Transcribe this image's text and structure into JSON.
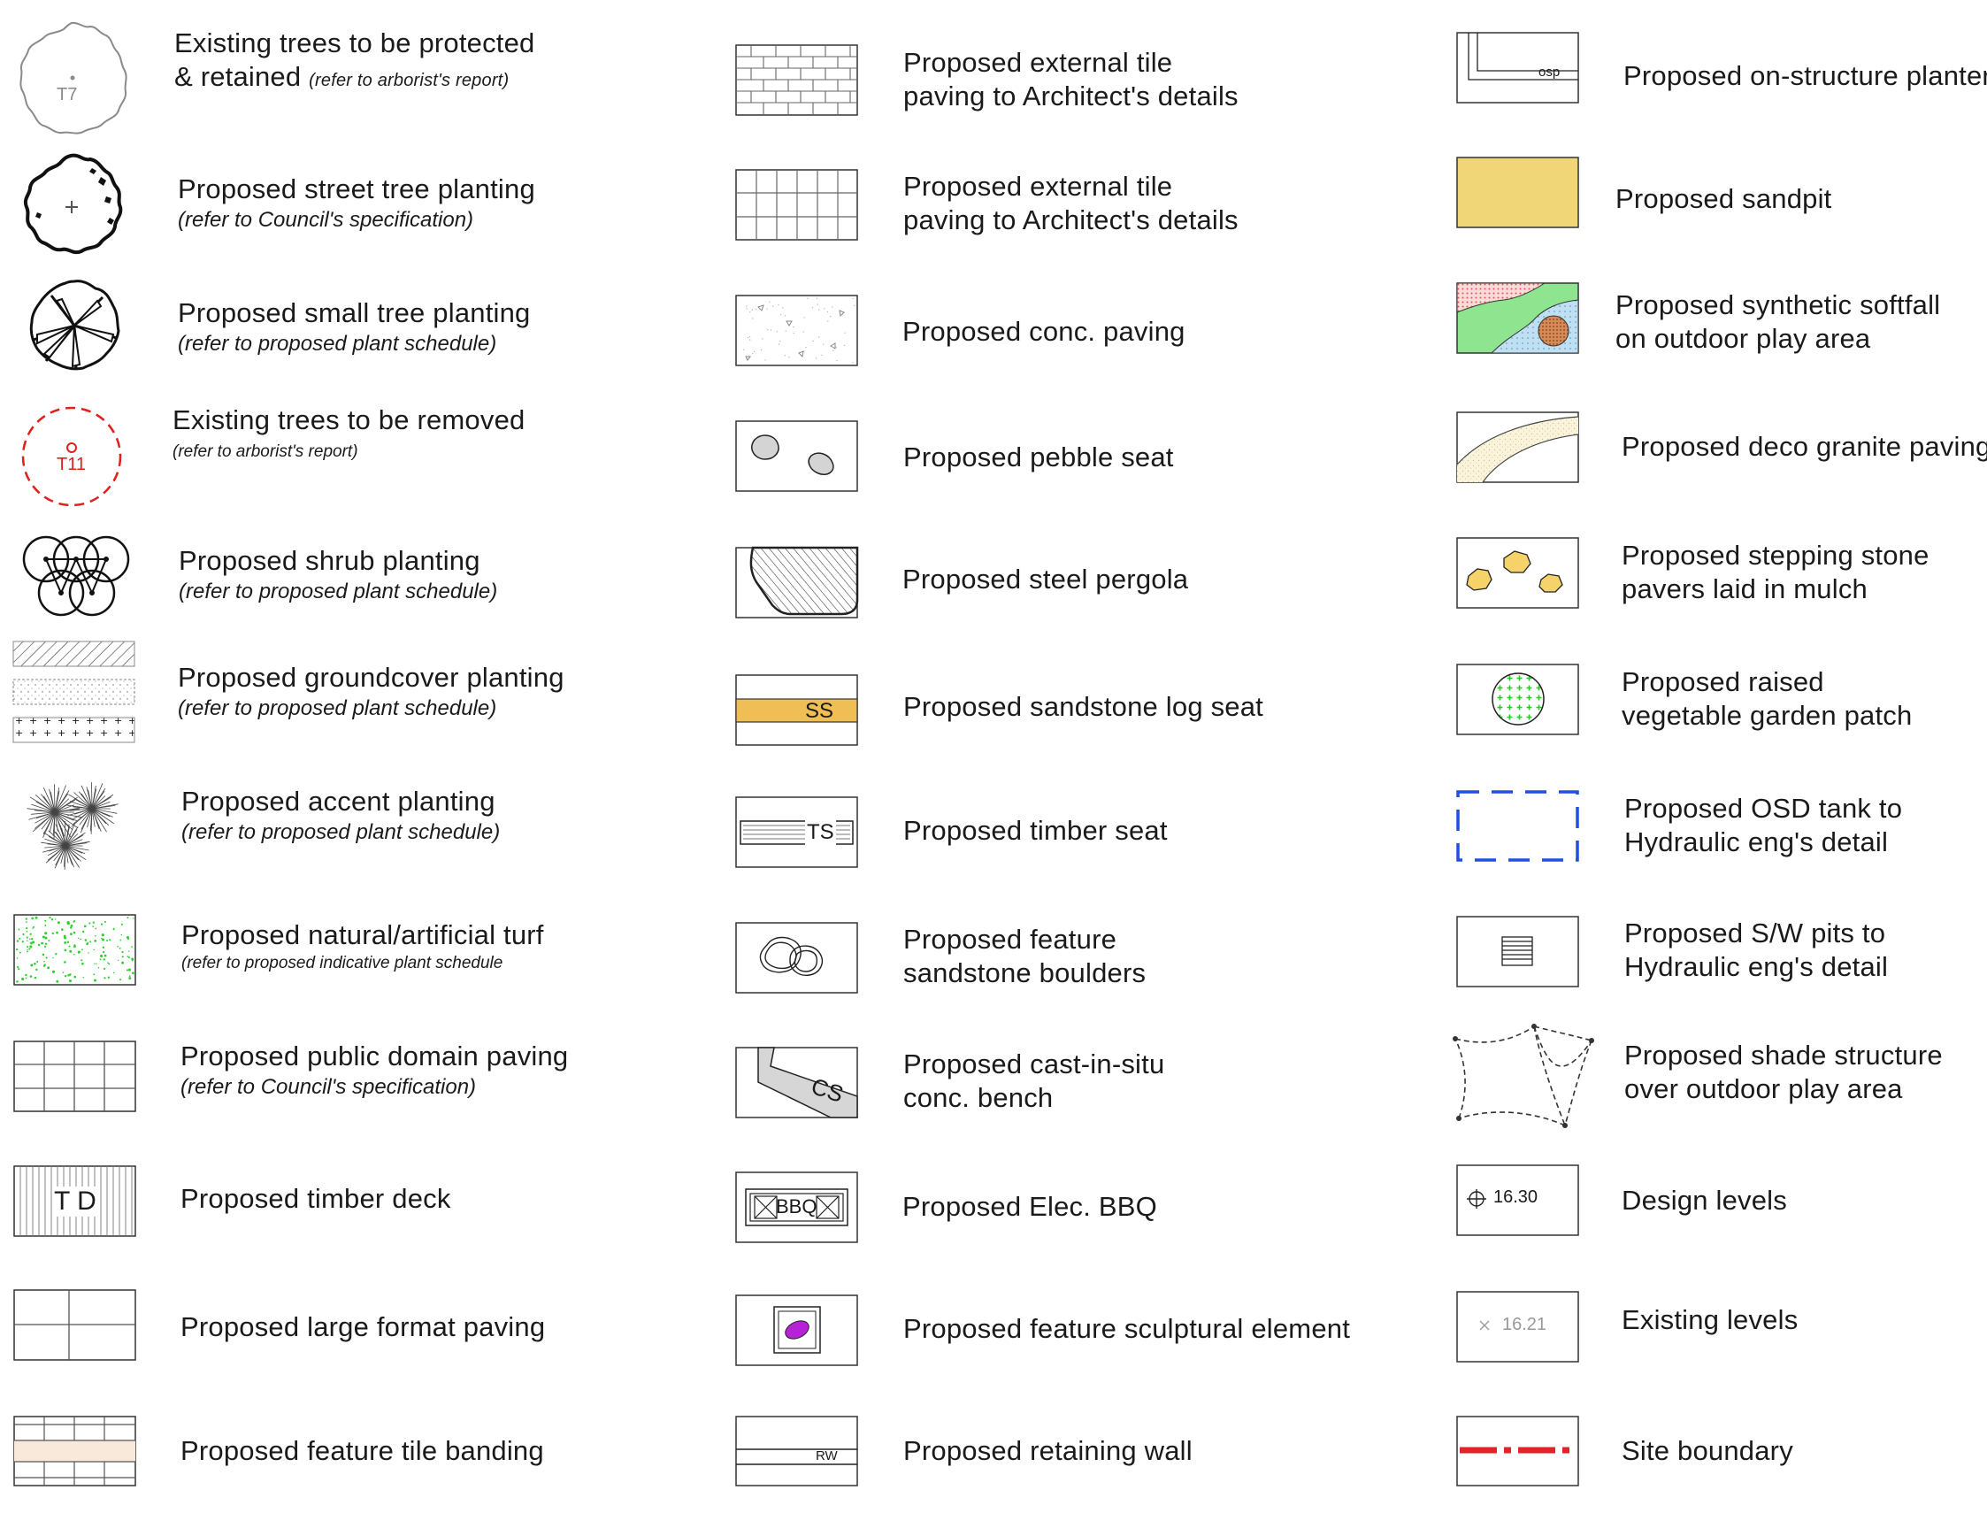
{
  "legend": {
    "column_1": [
      {
        "line1": "Existing trees to be protected",
        "line2": "& retained",
        "note": "(refer to arborist's report)",
        "tag": "T7"
      },
      {
        "line1": "Proposed street tree planting",
        "note": "(refer to Council's specification)"
      },
      {
        "line1": "Proposed small tree planting",
        "note": "(refer to proposed plant schedule)"
      },
      {
        "line1": "Existing trees to be removed",
        "note": "(refer to arborist's report)",
        "tag": "T11"
      },
      {
        "line1": "Proposed shrub planting",
        "note": "(refer to proposed plant schedule)"
      },
      {
        "line1": "Proposed groundcover planting",
        "note": "(refer to proposed plant schedule)"
      },
      {
        "line1": "Proposed accent planting",
        "note": "(refer to proposed plant schedule)"
      },
      {
        "line1": "Proposed natural/artificial turf",
        "note": "(refer to proposed indicative plant schedule"
      },
      {
        "line1": "Proposed public domain paving",
        "note": "(refer to Council's specification)"
      },
      {
        "line1": "Proposed timber deck",
        "tag": "T D"
      },
      {
        "line1": "Proposed large format paving"
      },
      {
        "line1": "Proposed feature tile banding"
      }
    ],
    "column_2": [
      {
        "line1": "Proposed external tile",
        "line2": "paving to Architect's details"
      },
      {
        "line1": "Proposed external tile",
        "line2": "paving to Architect's details"
      },
      {
        "line1": "Proposed conc. paving"
      },
      {
        "line1": "Proposed pebble seat"
      },
      {
        "line1": "Proposed steel pergola"
      },
      {
        "line1": "Proposed sandstone log seat",
        "tag": "SS"
      },
      {
        "line1": "Proposed timber seat",
        "tag": "TS"
      },
      {
        "line1": "Proposed feature",
        "line2": "sandstone boulders"
      },
      {
        "line1": "Proposed cast-in-situ",
        "line2": "conc. bench",
        "tag": "CS"
      },
      {
        "line1": "Proposed Elec. BBQ",
        "tag": "BBQ"
      },
      {
        "line1": "Proposed feature sculptural element"
      },
      {
        "line1": "Proposed retaining wall",
        "tag": "RW"
      }
    ],
    "column_3": [
      {
        "line1": "Proposed on-structure planter",
        "tag": "osp"
      },
      {
        "line1": "Proposed sandpit"
      },
      {
        "line1": "Proposed synthetic softfall",
        "line2": "on outdoor play area"
      },
      {
        "line1": "Proposed deco granite paving"
      },
      {
        "line1": "Proposed stepping stone",
        "line2": "pavers laid in mulch"
      },
      {
        "line1": "Proposed raised",
        "line2": "vegetable garden patch"
      },
      {
        "line1": "Proposed OSD tank to",
        "line2": "Hydraulic eng's detail"
      },
      {
        "line1": "Proposed S/W pits to",
        "line2": "Hydraulic eng's detail"
      },
      {
        "line1": "Proposed shade structure",
        "line2": "over outdoor play area"
      },
      {
        "line1": "Design levels",
        "tag": "16.30"
      },
      {
        "line1": "Existing levels",
        "tag": "16.21"
      },
      {
        "line1": "Site boundary"
      }
    ]
  },
  "colors": {
    "line": "#2a2a2a",
    "grey_line": "#8a8a8a",
    "removed_tree_red": "#e0201a",
    "sand_yellow": "#f0d677",
    "sandstone_orange": "#efbf55",
    "turf_green": "#2fcf2f",
    "softfall_green": "#8fe58f",
    "softfall_red_dots": "#f08a8a",
    "softfall_blue": "#bfe0f2",
    "softfall_brown": "#d88a55",
    "stepping_stone_yellow": "#f5d36a",
    "sculpture_purple": "#b623d6",
    "osd_blue": "#1f4fe0",
    "boundary_red": "#e3232a",
    "pebble_grey": "#d4d4d4"
  }
}
